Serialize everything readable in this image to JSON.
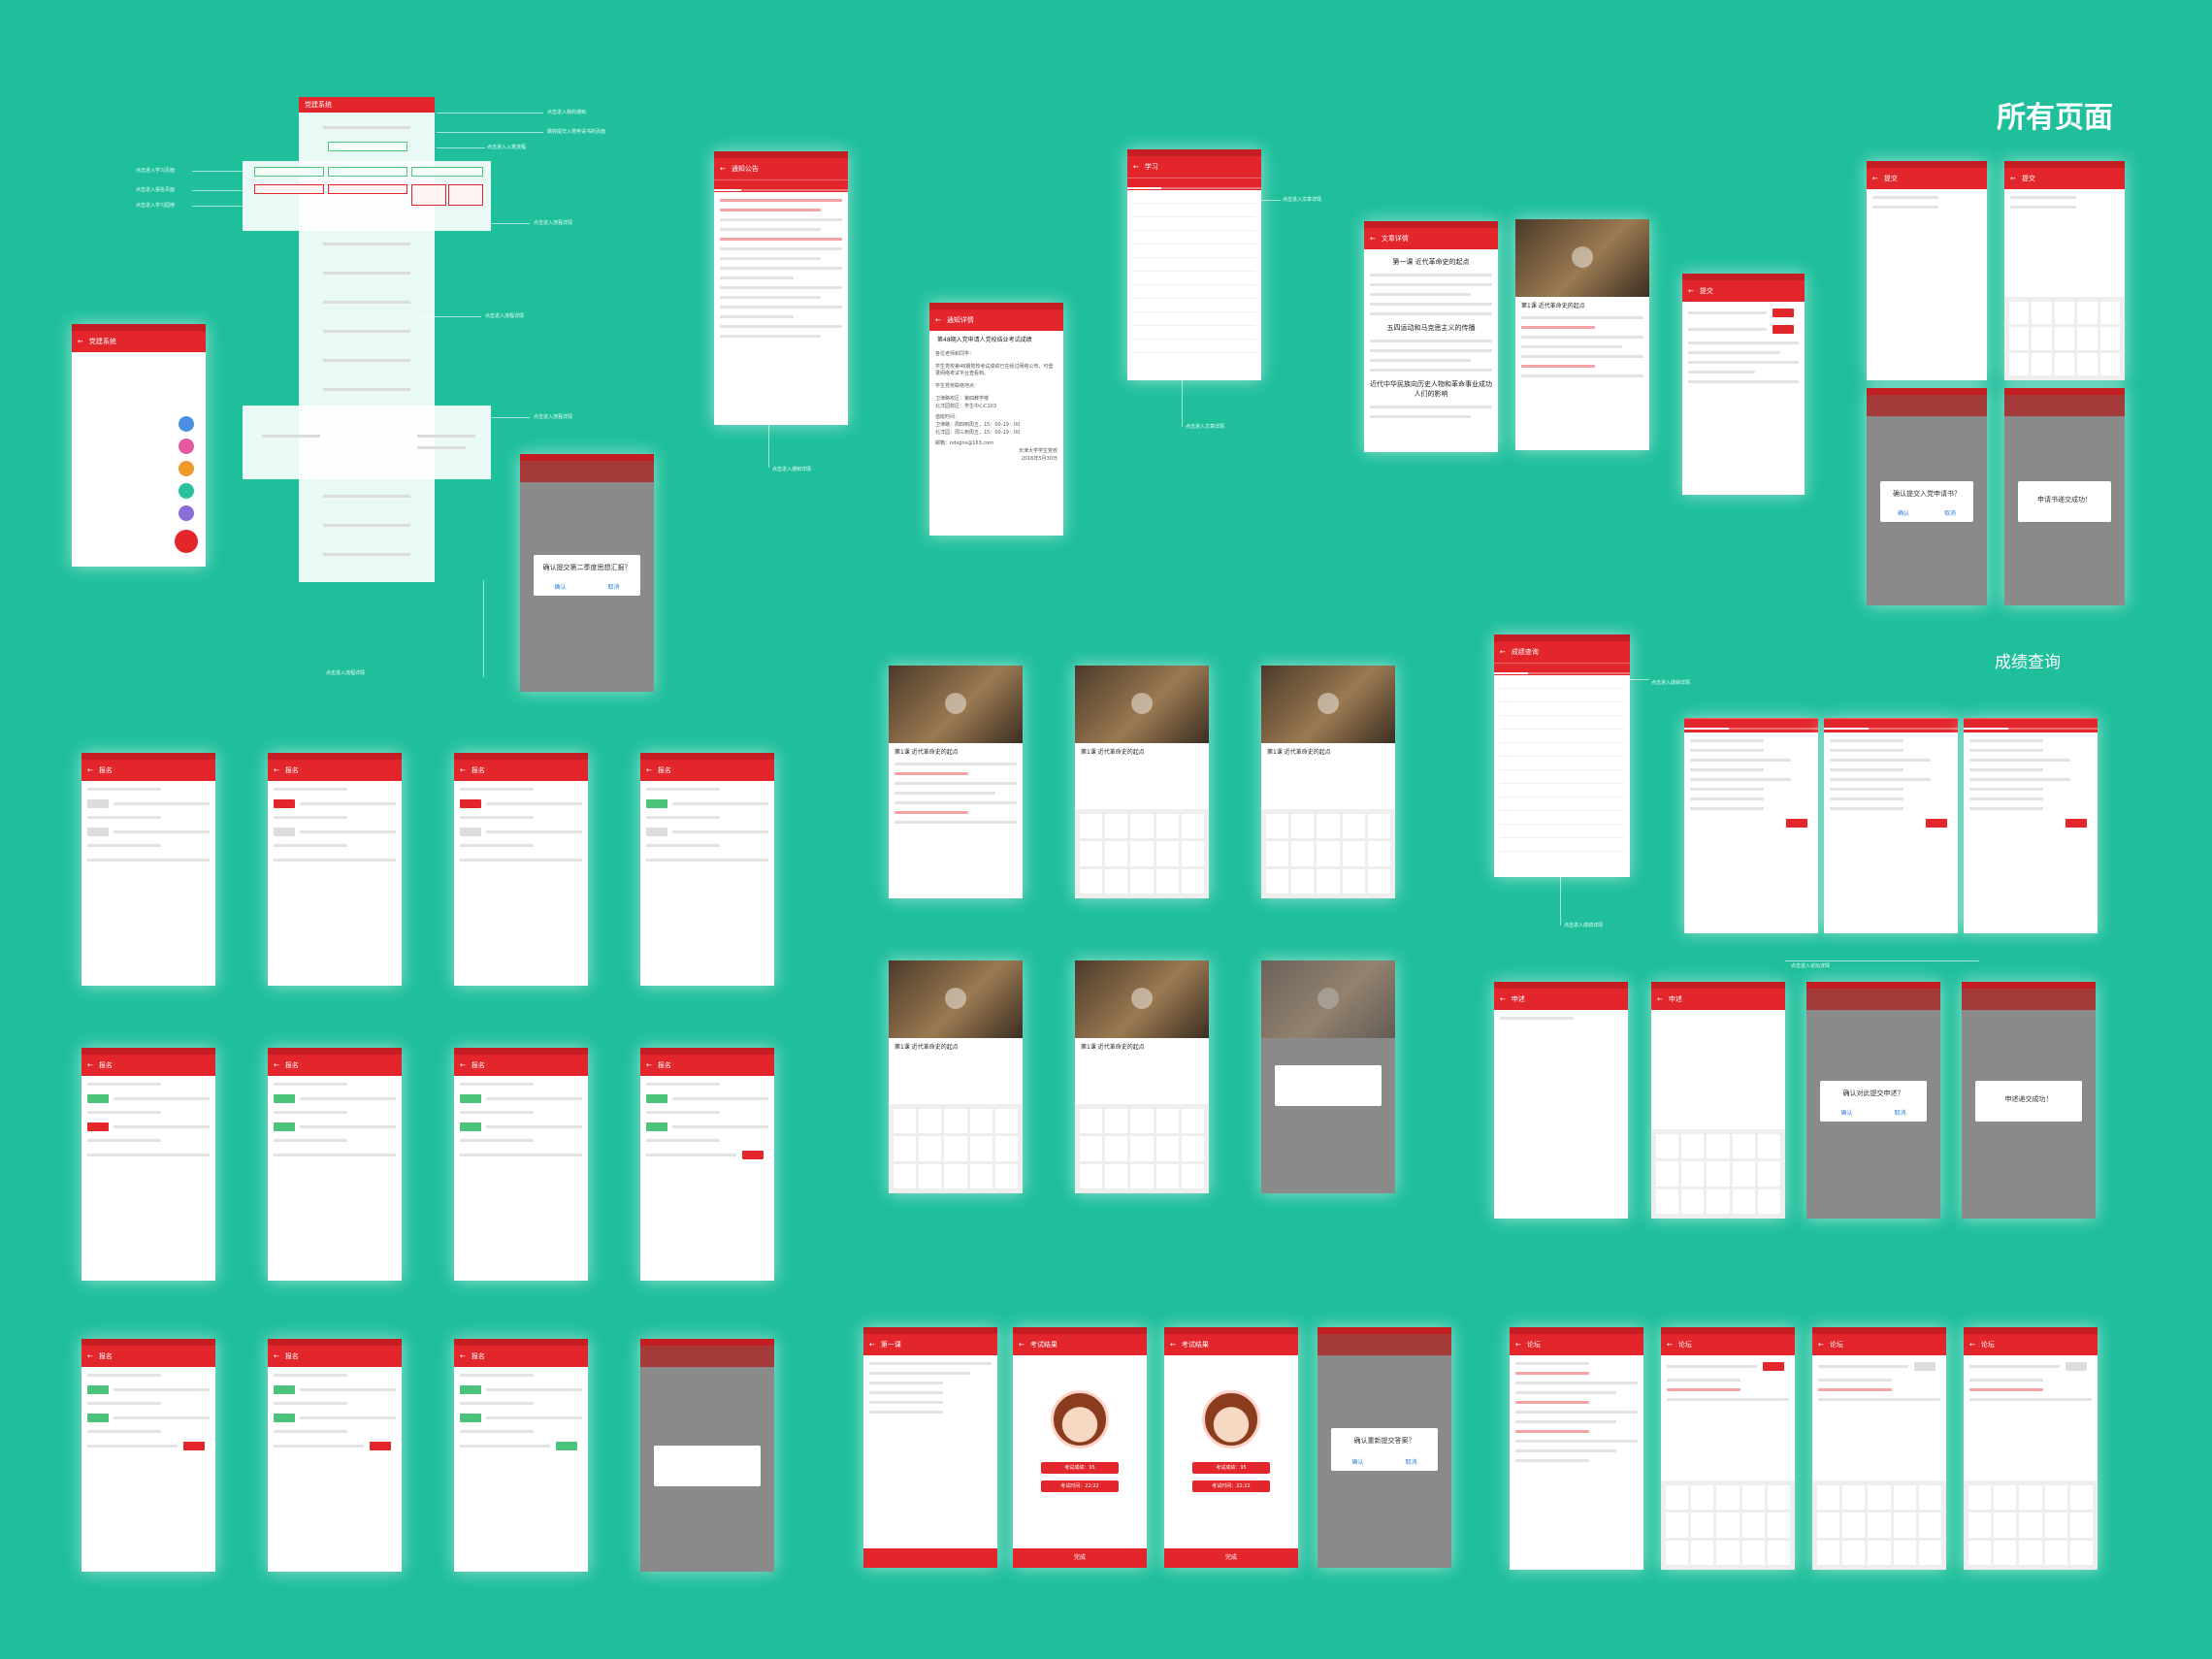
{
  "page_title": "所有页面",
  "section_label": "成绩查询",
  "main_title": "党建系统",
  "screens": {
    "notice_list": {
      "title": "通知公告"
    },
    "notice_detail": {
      "title": "通知详情",
      "heading": "第48期入党申请人党校结业考试成绩",
      "lines": [
        "各位老师和同学：",
        "学生党校第48期党校考试成绩已在经过网络公布，可登录网络考试平台查看到。",
        "学生党校联络地点：",
        "卫津路校区：第四教学楼",
        "北洋园校区：学生中心C103",
        "值班时间：",
        "卫津路：周四到周五，15：00-19：00",
        "北洋园：周三到周五，15：00-19：00",
        "邮箱：ndxgns@163.com",
        "天津大学学生党校",
        "2016年5月30日"
      ]
    },
    "study_list": {
      "title": "学习"
    },
    "article": {
      "title": "文章详情",
      "heading": "第一课 近代革命史的起点",
      "sub1": "五四运动和马克思主义的传播",
      "sub2": "近代中华民族向历史人物和革命事业成功人们的影响"
    },
    "video": {
      "caption": "第1课 近代革命史的起点"
    },
    "submit": {
      "title": "提交"
    },
    "confirm_submit": "确认提交入党申请书？",
    "submitted": "申请书递交成功！",
    "confirm_report": "确认提交第二季度思想汇报？",
    "confirm_exam": "确认重新提交答案？",
    "signup": {
      "title": "报名"
    },
    "exam_result": {
      "title": "考试结果",
      "score": "考试成绩：95",
      "time": "考试时间：22:22",
      "finish": "完成"
    },
    "exam": {
      "title": "第一课"
    },
    "appeal": {
      "title": "申述",
      "confirm": "确认对此提交申述？",
      "done": "申述递交成功！"
    },
    "discuss": {
      "title": "论坛"
    },
    "score_query": {
      "title": "成绩查询"
    }
  },
  "annotations": {
    "a1": "点击进入我的通知",
    "a2": "跳转提交入党申请书的页面",
    "a3": "点击进入入党流程",
    "a4": "点击进入学习页面",
    "a5": "点击进入报名页面",
    "a6": "点击进入学习园地",
    "a7": "点击进入流程详情",
    "a8": "点击进入文章详情",
    "a9": "点击进入通知详情",
    "a10": "点击进入成绩详情",
    "a11": "点击进入论坛详情"
  },
  "colors": {
    "background": "#1fbf9c",
    "primary": "#e2262c",
    "success": "#4cc37a"
  }
}
